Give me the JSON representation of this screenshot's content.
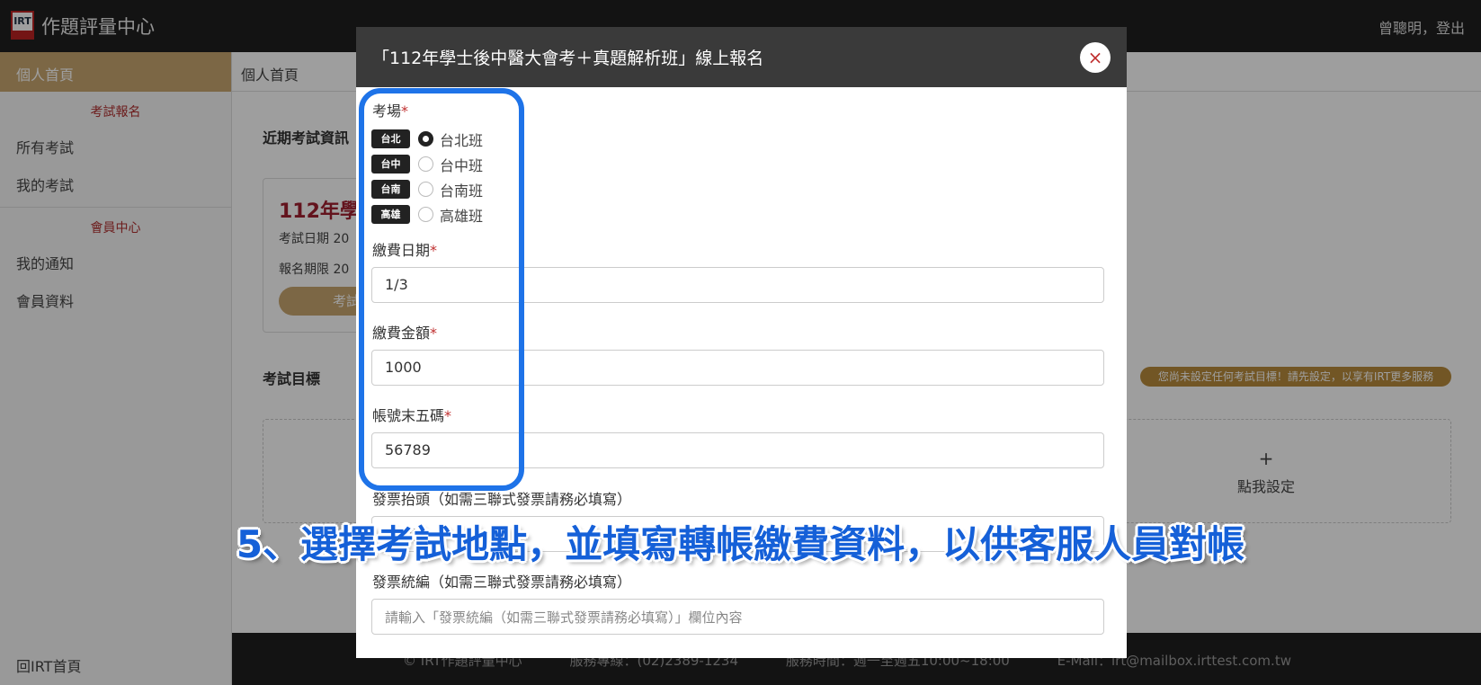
{
  "header": {
    "app_title": "作題評量中心",
    "user": "曾聰明，登出",
    "logo_text": "IRT"
  },
  "sidebar": {
    "home": "個人首頁",
    "section_exam": "考試報名",
    "all_exams": "所有考試",
    "my_exams": "我的考試",
    "section_member": "會員中心",
    "notifications": "我的通知",
    "profile": "會員資料",
    "footer_link": "回IRT首頁"
  },
  "main": {
    "breadcrumb": "個人首頁",
    "recent_title": "近期考試資訊",
    "card_title": "112年學",
    "card_date": "考試日期  20",
    "card_period": "報名期限  20",
    "card_button": "考試",
    "goal_title": "考試目標",
    "goal_badge": "您尚未設定任何考試目標！請先設定，以享有IRT更多服務",
    "goal_plus": "+",
    "goal_set": "點我設定"
  },
  "footer": {
    "copyright": "© IRT作題評量中心",
    "phone": "服務專線：(02)2389-1234",
    "hours": "服務時間：週一至週五10:00~18:00",
    "email": "E-Mail：irt@mailbox.irttest.com.tw"
  },
  "modal": {
    "title": "「112年學士後中醫大會考＋真題解析班」線上報名",
    "close_icon": "×",
    "venue_label": "考場",
    "required_mark": "*",
    "venues": [
      {
        "tag": "台北",
        "label": "台北班",
        "checked": true
      },
      {
        "tag": "台中",
        "label": "台中班",
        "checked": false
      },
      {
        "tag": "台南",
        "label": "台南班",
        "checked": false
      },
      {
        "tag": "高雄",
        "label": "高雄班",
        "checked": false
      }
    ],
    "pay_date_label": "繳費日期",
    "pay_date_value": "1/3",
    "pay_amount_label": "繳費金額",
    "pay_amount_value": "1000",
    "account_label": "帳號末五碼",
    "account_value": "56789",
    "invoice_title_label": "發票抬頭（如需三聯式發票請務必填寫）",
    "invoice_title_placeholder": "（如需",
    "invoice_id_label": "發票統編（如需三聯式發票請務必填寫）",
    "invoice_id_placeholder": "請輸入「發票統編（如需三聯式發票請務必填寫）」欄位內容"
  },
  "caption": "5、選擇考試地點，並填寫轉帳繳費資料，以供客服人員對帳",
  "colors": {
    "accent_gold": "#c9a770",
    "highlight_blue": "#1e73e8",
    "caption_blue": "#1560d8",
    "required_red": "#c03030"
  }
}
